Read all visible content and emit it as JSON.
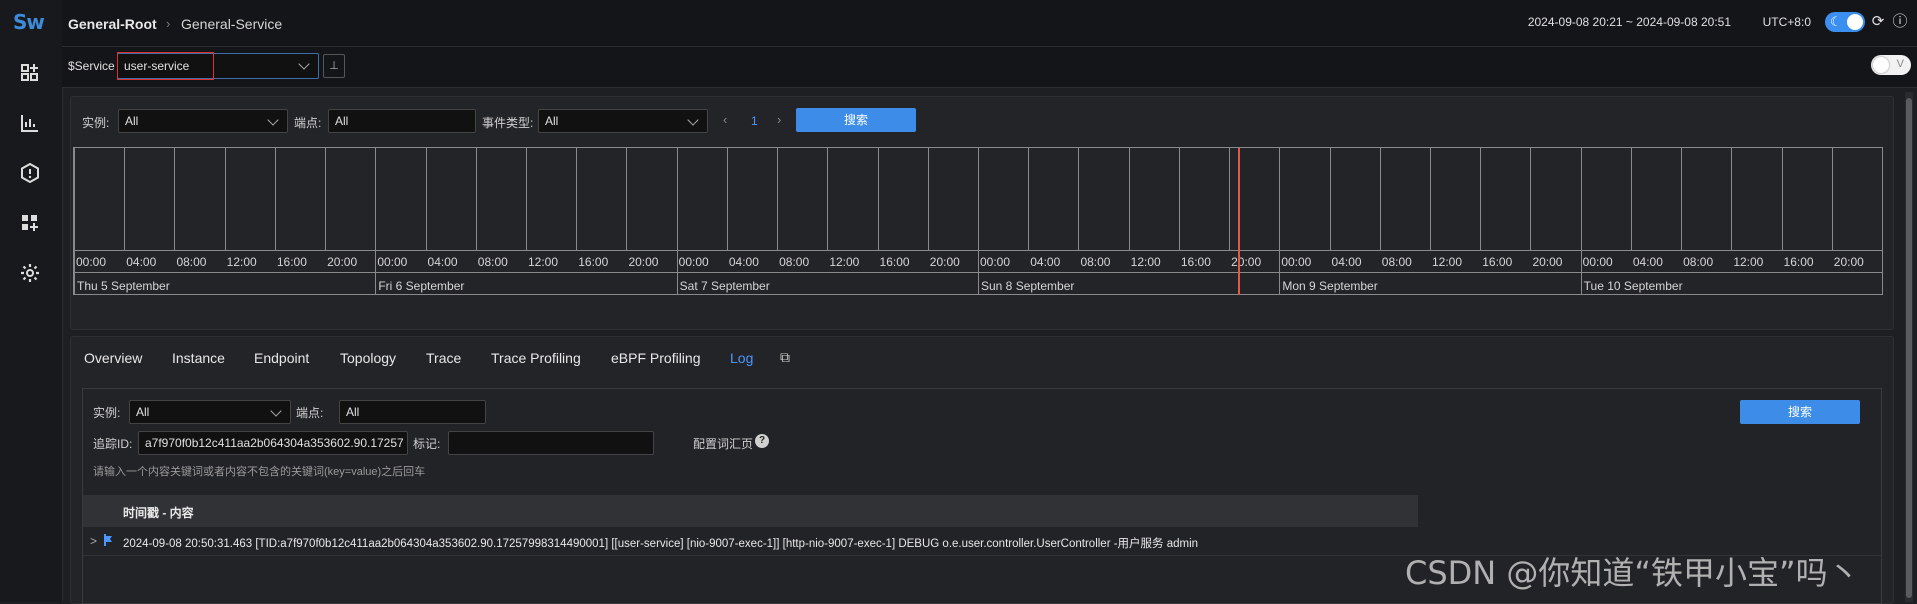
{
  "app": {
    "logo": "Sw"
  },
  "header": {
    "root": "General-Root",
    "service": "General-Service",
    "time_range": "2024-09-08 20:21 ~ 2024-09-08 20:51",
    "utc": "UTC+8:0"
  },
  "service_bar": {
    "label": "$Service",
    "selected": "user-service",
    "v_toggle": "V"
  },
  "events_filter": {
    "instance_label": "实例:",
    "instance_value": "All",
    "endpoint_label": "端点:",
    "endpoint_value": "All",
    "event_type_label": "事件类型:",
    "event_type_value": "All",
    "page": "1",
    "search": "搜索"
  },
  "timeline": {
    "ticks": [
      "00:00",
      "04:00",
      "08:00",
      "12:00",
      "16:00",
      "20:00"
    ],
    "days": [
      "Thu 5 September",
      "Fri 6 September",
      "Sat 7 September",
      "Sun 8 September",
      "Mon 9 September",
      "Tue 10 September"
    ],
    "now_color": "#e05a4a"
  },
  "tabs": [
    {
      "label": "Overview",
      "active": false
    },
    {
      "label": "Instance",
      "active": false
    },
    {
      "label": "Endpoint",
      "active": false
    },
    {
      "label": "Topology",
      "active": false
    },
    {
      "label": "Trace",
      "active": false
    },
    {
      "label": "Trace Profiling",
      "active": false
    },
    {
      "label": "eBPF Profiling",
      "active": false
    },
    {
      "label": "Log",
      "active": true
    }
  ],
  "log_filter": {
    "instance_label": "实例:",
    "instance_value": "All",
    "endpoint_label": "端点:",
    "endpoint_value": "All",
    "trace_label": "追踪ID:",
    "trace_value": "a7f970f0b12c411aa2b064304a353602.90.17257",
    "tag_label": "标记:",
    "tag_value": "",
    "keywords_label": "配置词汇页",
    "hint": "请输入一个内容关键词或者内容不包含的关键词(key=value)之后回车",
    "search": "搜索"
  },
  "log_table": {
    "header": "时间戳 - 内容",
    "rows": [
      "2024-09-08 20:50:31.463 [TID:a7f970f0b12c411aa2b064304a353602.90.17257998314490001] [[user-service] [nio-9007-exec-1]] [http-nio-9007-exec-1] DEBUG o.e.user.controller.UserController -用户服务 admin"
    ]
  },
  "watermark": "CSDN @你知道“铁甲小宝”吗丶",
  "colors": {
    "accent": "#3d8de8",
    "active_tab": "#4c97ff",
    "highlight": "#e0302f"
  }
}
